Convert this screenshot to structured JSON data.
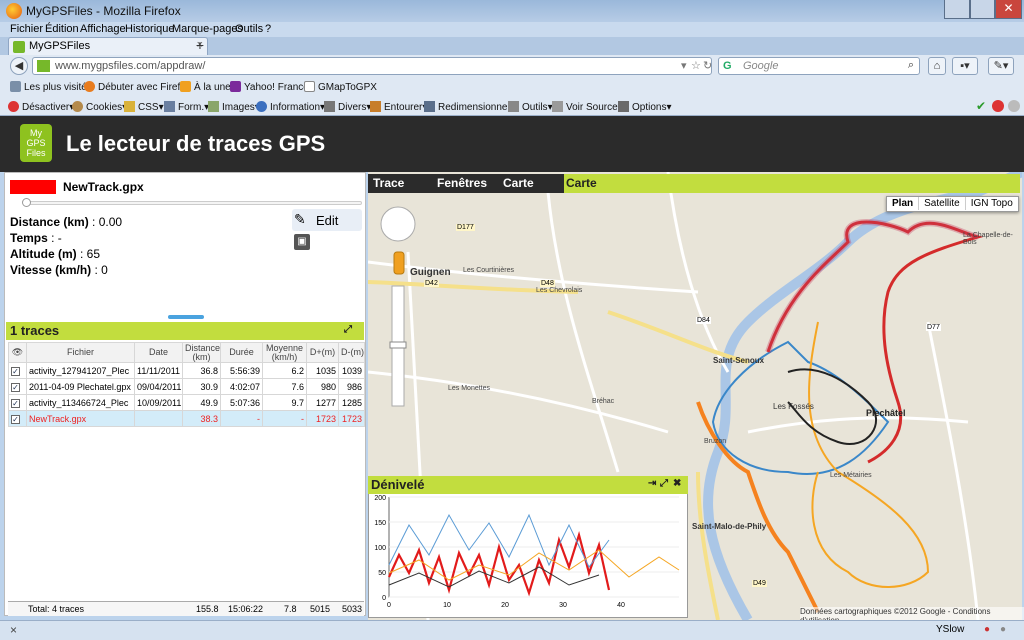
{
  "window": {
    "title": "MyGPSFiles - Mozilla Firefox"
  },
  "menu": [
    "Fichier",
    "Édition",
    "Affichage",
    "Historique",
    "Marque-pages",
    "Outils",
    "?"
  ],
  "tab": {
    "label": "MyGPSFiles",
    "close": "×",
    "new": "+"
  },
  "nav": {
    "url": "www.mygpsfiles.com/appdraw/",
    "search_placeholder": "Google",
    "search_engine": "G"
  },
  "bookmarks": [
    "Les plus visités",
    "Débuter avec Firefox",
    "À la une",
    "Yahoo! France",
    "GMapToGPX"
  ],
  "devtools": [
    "Désactiver",
    "Cookies",
    "CSS",
    "Form.",
    "Images",
    "Information",
    "Divers",
    "Entourer",
    "Redimensionner",
    "Outils",
    "Voir Source",
    "Options"
  ],
  "app": {
    "logo": [
      "My",
      "GPS",
      "Files"
    ],
    "title": "Le lecteur de traces GPS"
  },
  "track": {
    "name": "NewTrack.gpx",
    "color": "#ff0000",
    "stats": [
      {
        "label": "Distance (km)",
        "value": " : 0.00"
      },
      {
        "label": "Temps",
        "value": " : -"
      },
      {
        "label": "Altitude (m)",
        "value": " : 65"
      },
      {
        "label": "Vitesse (km/h)",
        "value": " : 0"
      }
    ],
    "edit": "Edit"
  },
  "traces": {
    "title": "1 traces",
    "headers": [
      "Fichier",
      "Date",
      "Distance (km)",
      "Durée",
      "Moyenne (km/h)",
      "D+(m)",
      "D-(m)"
    ],
    "rows": [
      {
        "file": "activity_127941207_Plec",
        "date": "11/11/2011",
        "dist": "36.8",
        "dur": "5:56:39",
        "avg": "6.2",
        "dp": "1035",
        "dm": "1039"
      },
      {
        "file": "2011-04-09 Plechatel.gpx",
        "date": "09/04/2011",
        "dist": "30.9",
        "dur": "4:02:07",
        "avg": "7.6",
        "dp": "980",
        "dm": "986"
      },
      {
        "file": "activity_113466724_Plec",
        "date": "10/09/2011",
        "dist": "49.9",
        "dur": "5:07:36",
        "avg": "9.7",
        "dp": "1277",
        "dm": "1285"
      },
      {
        "file": "NewTrack.gpx",
        "date": "",
        "dist": "38.3",
        "dur": "-",
        "avg": "-",
        "dp": "1723",
        "dm": "1723"
      }
    ],
    "total": {
      "label": "Total: 4 traces",
      "dist": "155.8",
      "dur": "15:06:22",
      "avg": "7.8",
      "dp": "5015",
      "dm": "5033"
    }
  },
  "maptabs": {
    "trace": "Trace",
    "fenetres": "Fenêtres",
    "carte": "Carte",
    "active": "Carte"
  },
  "maptype": [
    "Plan",
    "Satellite",
    "IGN Topo"
  ],
  "places": [
    "Guignen",
    "Les Courtinières",
    "Les Chevrolais",
    "La Bigotière",
    "La Noë",
    "Le Plessis",
    "La Motte",
    "La Brosse",
    "Les Monettes",
    "Les Fossés",
    "Bréhac",
    "Saint-Senoux",
    "Bruzon",
    "Saint-Malo-de-Phily",
    "Plechâtel",
    "Les Métairies",
    "Rue des Marais",
    "La Chapelle-de-Bois",
    "La Vilaine",
    "Le Gautron",
    "La Bardais"
  ],
  "roads": [
    "D177",
    "D48",
    "D42",
    "D84",
    "D77",
    "D49",
    "D65"
  ],
  "elevation": {
    "title": "Dénivelé",
    "yticks": [
      "0",
      "50",
      "100",
      "150",
      "200"
    ],
    "xticks": [
      "0",
      "10",
      "20",
      "30",
      "40"
    ],
    "ymax": 200,
    "xmax": 50
  },
  "copyright": "Données cartographiques ©2012 Google - Conditions d'utilisation",
  "status": {
    "close": "×",
    "yslow": "YSlow"
  }
}
